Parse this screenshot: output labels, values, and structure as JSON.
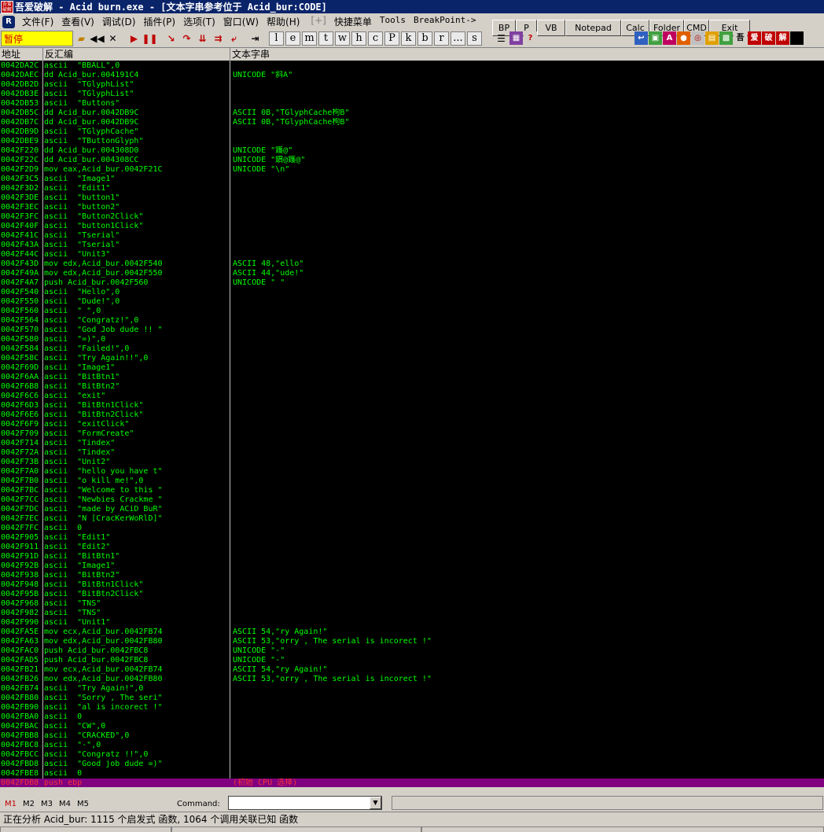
{
  "window": {
    "app_name": "吾爱破解",
    "title": "吾爱破解 - Acid burn.exe - [文本字串参考位于 Acid_bur:CODE]"
  },
  "menu": [
    {
      "label": "文件(F)",
      "disabled": false
    },
    {
      "label": "查看(V)",
      "disabled": false
    },
    {
      "label": "调试(D)",
      "disabled": false
    },
    {
      "label": "插件(P)",
      "disabled": false
    },
    {
      "label": "选项(T)",
      "disabled": false
    },
    {
      "label": "窗口(W)",
      "disabled": false
    },
    {
      "label": "帮助(H)",
      "disabled": false
    },
    {
      "label": "[+]",
      "disabled": true
    },
    {
      "label": "快捷菜单",
      "disabled": false
    },
    {
      "label": "Tools",
      "disabled": false
    },
    {
      "label": "BreakPoint->",
      "disabled": false
    }
  ],
  "quick_buttons": [
    "BP",
    "P",
    "VB",
    "Notepad",
    "Calc",
    "Folder",
    "CMD",
    "Exit"
  ],
  "toolbar": {
    "state": "暂停",
    "letters": [
      "l",
      "e",
      "m",
      "t",
      "w",
      "h",
      "c",
      "P",
      "k",
      "b",
      "r",
      "...",
      "s"
    ],
    "right_icons": [
      "吾",
      "爱",
      "破",
      "解"
    ]
  },
  "columns": {
    "address": "地址",
    "disasm": "反汇编",
    "text": "文本字串"
  },
  "rows": [
    [
      "0042DA2C",
      "ascii  \"BBALL\",0",
      ""
    ],
    [
      "0042DAEC",
      "dd Acid_bur.004191C4",
      "UNICODE \"斜A\""
    ],
    [
      "0042DB2D",
      "ascii  \"TGlyphList\"",
      ""
    ],
    [
      "0042DB3E",
      "ascii  \"TGlyphList\"",
      ""
    ],
    [
      "0042DB53",
      "ascii  \"Buttons\"",
      ""
    ],
    [
      "0042DB5C",
      "dd Acid_bur.0042DB9C",
      "ASCII 0B,\"TGlyphCache枸B\""
    ],
    [
      "0042DB7C",
      "dd Acid_bur.0042DB9C",
      "ASCII 0B,\"TGlyphCache枸B\""
    ],
    [
      "0042DB9D",
      "ascii  \"TGlyphCache\"",
      ""
    ],
    [
      "0042DBE9",
      "ascii  \"TButtonGlyph\"",
      ""
    ],
    [
      "0042F220",
      "dd Acid_bur.004308D0",
      "UNICODE \"鑊@\""
    ],
    [
      "0042F22C",
      "dd Acid_bur.004308CC",
      "UNICODE \"鑜@鑊@\""
    ],
    [
      "0042F2D9",
      "mov eax,Acid_bur.0042F21C",
      "UNICODE \"\\n\""
    ],
    [
      "0042F3C5",
      "ascii  \"Image1\"",
      ""
    ],
    [
      "0042F3D2",
      "ascii  \"Edit1\"",
      ""
    ],
    [
      "0042F3DE",
      "ascii  \"button1\"",
      ""
    ],
    [
      "0042F3EC",
      "ascii  \"button2\"",
      ""
    ],
    [
      "0042F3FC",
      "ascii  \"Button2Click\"",
      ""
    ],
    [
      "0042F40F",
      "ascii  \"button1Click\"",
      ""
    ],
    [
      "0042F41C",
      "ascii  \"Tserial\"",
      ""
    ],
    [
      "0042F43A",
      "ascii  \"Tserial\"",
      ""
    ],
    [
      "0042F44C",
      "ascii  \"Unit3\"",
      ""
    ],
    [
      "0042F43D",
      "mov edx,Acid_bur.0042F540",
      "ASCII 48,\"ello\""
    ],
    [
      "0042F49A",
      "mov edx,Acid_bur.0042F550",
      "ASCII 44,\"ude!\""
    ],
    [
      "0042F4A7",
      "push Acid_bur.0042F560",
      "UNICODE \" \""
    ],
    [
      "0042F540",
      "ascii  \"Hello\",0",
      ""
    ],
    [
      "0042F550",
      "ascii  \"Dude!\",0",
      ""
    ],
    [
      "0042F560",
      "ascii  \" \",0",
      ""
    ],
    [
      "0042F564",
      "ascii  \"Congratz!\",0",
      ""
    ],
    [
      "0042F570",
      "ascii  \"God Job dude !! \"",
      ""
    ],
    [
      "0042F580",
      "ascii  \"=)\",0",
      ""
    ],
    [
      "0042F584",
      "ascii  \"Failed!\",0",
      ""
    ],
    [
      "0042F58C",
      "ascii  \"Try Again!!\",0",
      ""
    ],
    [
      "0042F69D",
      "ascii  \"Image1\"",
      ""
    ],
    [
      "0042F6AA",
      "ascii  \"BitBtn1\"",
      ""
    ],
    [
      "0042F6B8",
      "ascii  \"BitBtn2\"",
      ""
    ],
    [
      "0042F6C6",
      "ascii  \"exit\"",
      ""
    ],
    [
      "0042F6D3",
      "ascii  \"BitBtn1Click\"",
      ""
    ],
    [
      "0042F6E6",
      "ascii  \"BitBtn2Click\"",
      ""
    ],
    [
      "0042F6F9",
      "ascii  \"exitClick\"",
      ""
    ],
    [
      "0042F709",
      "ascii  \"FormCreate\"",
      ""
    ],
    [
      "0042F714",
      "ascii  \"Tindex\"",
      ""
    ],
    [
      "0042F72A",
      "ascii  \"Tindex\"",
      ""
    ],
    [
      "0042F73B",
      "ascii  \"Unit2\"",
      ""
    ],
    [
      "0042F7A0",
      "ascii  \"hello you have t\"",
      ""
    ],
    [
      "0042F7B0",
      "ascii  \"o kill me!\",0",
      ""
    ],
    [
      "0042F7BC",
      "ascii  \"Welcome to this \"",
      ""
    ],
    [
      "0042F7CC",
      "ascii  \"Newbies Crackme \"",
      ""
    ],
    [
      "0042F7DC",
      "ascii  \"made by ACiD BuR\"",
      ""
    ],
    [
      "0042F7EC",
      "ascii  \"N [CracKerWoRlD]\"",
      ""
    ],
    [
      "0042F7FC",
      "ascii  0",
      ""
    ],
    [
      "0042F905",
      "ascii  \"Edit1\"",
      ""
    ],
    [
      "0042F911",
      "ascii  \"Edit2\"",
      ""
    ],
    [
      "0042F91D",
      "ascii  \"BitBtn1\"",
      ""
    ],
    [
      "0042F92B",
      "ascii  \"Image1\"",
      ""
    ],
    [
      "0042F938",
      "ascii  \"BitBtn2\"",
      ""
    ],
    [
      "0042F948",
      "ascii  \"BitBtn1Click\"",
      ""
    ],
    [
      "0042F95B",
      "ascii  \"BitBtn2Click\"",
      ""
    ],
    [
      "0042F968",
      "ascii  \"TNS\"",
      ""
    ],
    [
      "0042F982",
      "ascii  \"TNS\"",
      ""
    ],
    [
      "0042F990",
      "ascii  \"Unit1\"",
      ""
    ],
    [
      "0042FA5E",
      "mov ecx,Acid_bur.0042FB74",
      "ASCII 54,\"ry Again!\""
    ],
    [
      "0042FA63",
      "mov edx,Acid_bur.0042FB80",
      "ASCII 53,\"orry , The serial is incorect !\""
    ],
    [
      "0042FAC0",
      "push Acid_bur.0042FBC8",
      "UNICODE \"-\""
    ],
    [
      "0042FAD5",
      "push Acid_bur.0042FBC8",
      "UNICODE \"-\""
    ],
    [
      "0042FB21",
      "mov ecx,Acid_bur.0042FB74",
      "ASCII 54,\"ry Again!\""
    ],
    [
      "0042FB26",
      "mov edx,Acid_bur.0042FB80",
      "ASCII 53,\"orry , The serial is incorect !\""
    ],
    [
      "0042FB74",
      "ascii  \"Try Again!\",0",
      ""
    ],
    [
      "0042FB80",
      "ascii  \"Sorry , The seri\"",
      ""
    ],
    [
      "0042FB90",
      "ascii  \"al is incorect !\"",
      ""
    ],
    [
      "0042FBA0",
      "ascii  0",
      ""
    ],
    [
      "0042FBAC",
      "ascii  \"CW\",0",
      ""
    ],
    [
      "0042FBB8",
      "ascii  \"CRACKED\",0",
      ""
    ],
    [
      "0042FBC8",
      "ascii  \"-\",0",
      ""
    ],
    [
      "0042FBCC",
      "ascii  \"Congratz !!\",0",
      ""
    ],
    [
      "0042FBD8",
      "ascii  \"Good job dude =)\"",
      ""
    ],
    [
      "0042FBE8",
      "ascii  0",
      ""
    ],
    [
      "0042FDB8",
      "push ebp",
      "(初始 CPU 选择)"
    ]
  ],
  "selected_row": 76,
  "bottom_tabs": [
    "M1",
    "M2",
    "M3",
    "M4",
    "M5"
  ],
  "command": {
    "label": "Command:",
    "value": ""
  },
  "status": "正在分析 Acid_bur: 1115 个启发式 函数, 1064 个调用关联已知 函数",
  "colors": {
    "text_green": "#00ff00",
    "selected_bg": "#800080",
    "selected_fg": "#ff3333",
    "state_bg": "#ffff00",
    "title_bg": "#0a246a"
  }
}
